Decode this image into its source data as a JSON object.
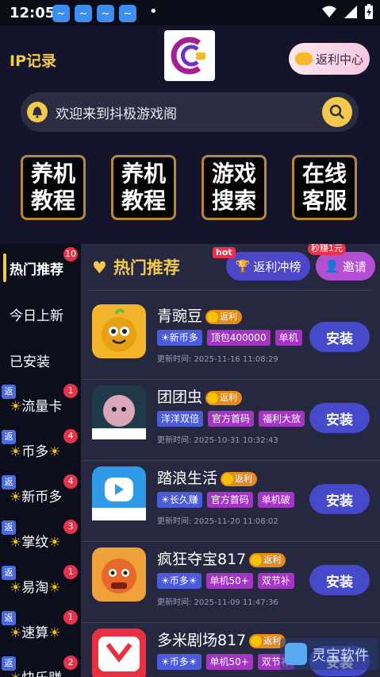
{
  "status_bar": {
    "time": "12:05"
  },
  "header": {
    "ip_label": "IP记录",
    "rebate_center": "返利中心",
    "notice": "欢迎来到抖极游戏阁",
    "tiles": [
      {
        "line1": "养机",
        "line2": "教程"
      },
      {
        "line1": "养机",
        "line2": "教程"
      },
      {
        "line1": "游戏",
        "line2": "搜索"
      },
      {
        "line1": "在线",
        "line2": "客服"
      }
    ]
  },
  "sidebar": {
    "items": [
      {
        "label": "热门推荐",
        "badge": "10"
      },
      {
        "label": "今日上新"
      },
      {
        "label": "已安装"
      },
      {
        "label": "流量卡",
        "badge": "1",
        "fan": "返"
      },
      {
        "label": "币多",
        "badge": "4",
        "fan": "返"
      },
      {
        "label": "新币多",
        "badge": "4",
        "fan": "返"
      },
      {
        "label": "掌纹",
        "badge": "3",
        "fan": "返"
      },
      {
        "label": "易淘",
        "badge": "1",
        "fan": "返"
      },
      {
        "label": "速算",
        "badge": "1",
        "fan": "返"
      },
      {
        "label": "快乐赚",
        "badge": "2",
        "fan": "返"
      }
    ]
  },
  "main": {
    "title": "热门推荐",
    "rank_btn": "返利冲榜",
    "hot_tag": "hot",
    "invite_btn": "邀请",
    "earn_tag": "秒赚1元",
    "fanli_label": "返利",
    "install_label": "安装",
    "games": [
      {
        "name": "青豌豆",
        "tags": [
          "☀新币多",
          "顶包400000",
          "单机"
        ],
        "time": "更新时间: 2025-11-16 11:08:29"
      },
      {
        "name": "团团虫",
        "tags": [
          "洋洋双倍",
          "官方首码",
          "福利大放"
        ],
        "time": "更新时间: 2025-10-31 10:32:43"
      },
      {
        "name": "踏浪生活",
        "tags": [
          "☀长久赚",
          "官方首码",
          "单机破"
        ],
        "time": "更新时间: 2025-11-20 11:08:02"
      },
      {
        "name": "疯狂夺宝817",
        "tags": [
          "☀币多☀",
          "单机50+",
          "双节补"
        ],
        "time": "更新时间: 2025-11-09 11:47:36"
      },
      {
        "name": "多米剧场817",
        "tags": [
          "☀币多☀",
          "单机50+",
          "双节补"
        ],
        "time": ""
      }
    ]
  },
  "watermark": {
    "text": "灵宝软件"
  },
  "colors": {
    "accent": "#f2c94c",
    "install": "#4649c9",
    "badge": "#e8314a"
  }
}
